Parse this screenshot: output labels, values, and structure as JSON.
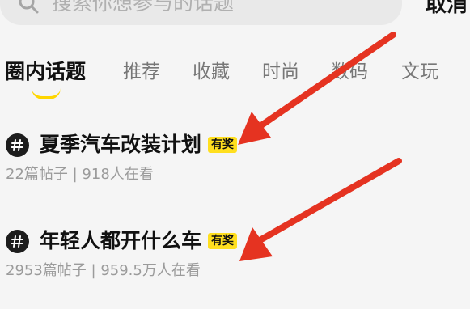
{
  "search": {
    "placeholder": "搜索你想参与的话题",
    "cancel_label": "取消"
  },
  "tabs": [
    {
      "label": "圈内话题",
      "active": true
    },
    {
      "label": "推荐",
      "active": false
    },
    {
      "label": "收藏",
      "active": false
    },
    {
      "label": "时尚",
      "active": false
    },
    {
      "label": "数码",
      "active": false
    },
    {
      "label": "文玩",
      "active": false
    }
  ],
  "topics": [
    {
      "title": "夏季汽车改装计划",
      "badge": "有奖",
      "meta": "22篇帖子 | 918人在看"
    },
    {
      "title": "年轻人都开什么车",
      "badge": "有奖",
      "meta": "2953篇帖子 | 959.5万人在看"
    }
  ],
  "colors": {
    "accent": "#ffd600",
    "badge": "#ffdf1f",
    "arrow": "#e53321",
    "text": "#111111",
    "muted": "#9b9b9b",
    "background": "#f5f5f5"
  },
  "icons": {
    "search": "search-icon",
    "topic": "hash-icon",
    "annotation": "red-arrow-icon"
  }
}
